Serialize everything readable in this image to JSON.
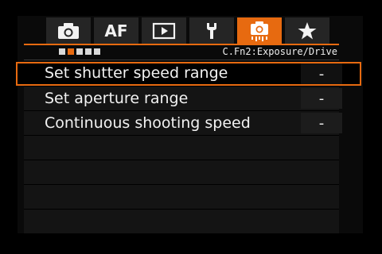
{
  "tabs": [
    {
      "name": "shooting",
      "icon": "camera-icon",
      "label": ""
    },
    {
      "name": "af",
      "icon": "af-icon",
      "label": "AF"
    },
    {
      "name": "playback",
      "icon": "play-icon",
      "label": ""
    },
    {
      "name": "setup",
      "icon": "wrench-icon",
      "label": ""
    },
    {
      "name": "custom-functions",
      "icon": "camera-custom-icon",
      "label": "",
      "active": true
    },
    {
      "name": "my-menu",
      "icon": "star-icon",
      "label": ""
    }
  ],
  "accent_color": "#e76a10",
  "subheader": {
    "page_count": 5,
    "active_page": 2,
    "section_title": "C.Fn2:Exposure/Drive"
  },
  "menu": {
    "items": [
      {
        "label": "Set shutter speed range",
        "value": "-",
        "selected": true
      },
      {
        "label": "Set aperture range",
        "value": "-"
      },
      {
        "label": "Continuous shooting speed",
        "value": "-"
      }
    ]
  }
}
